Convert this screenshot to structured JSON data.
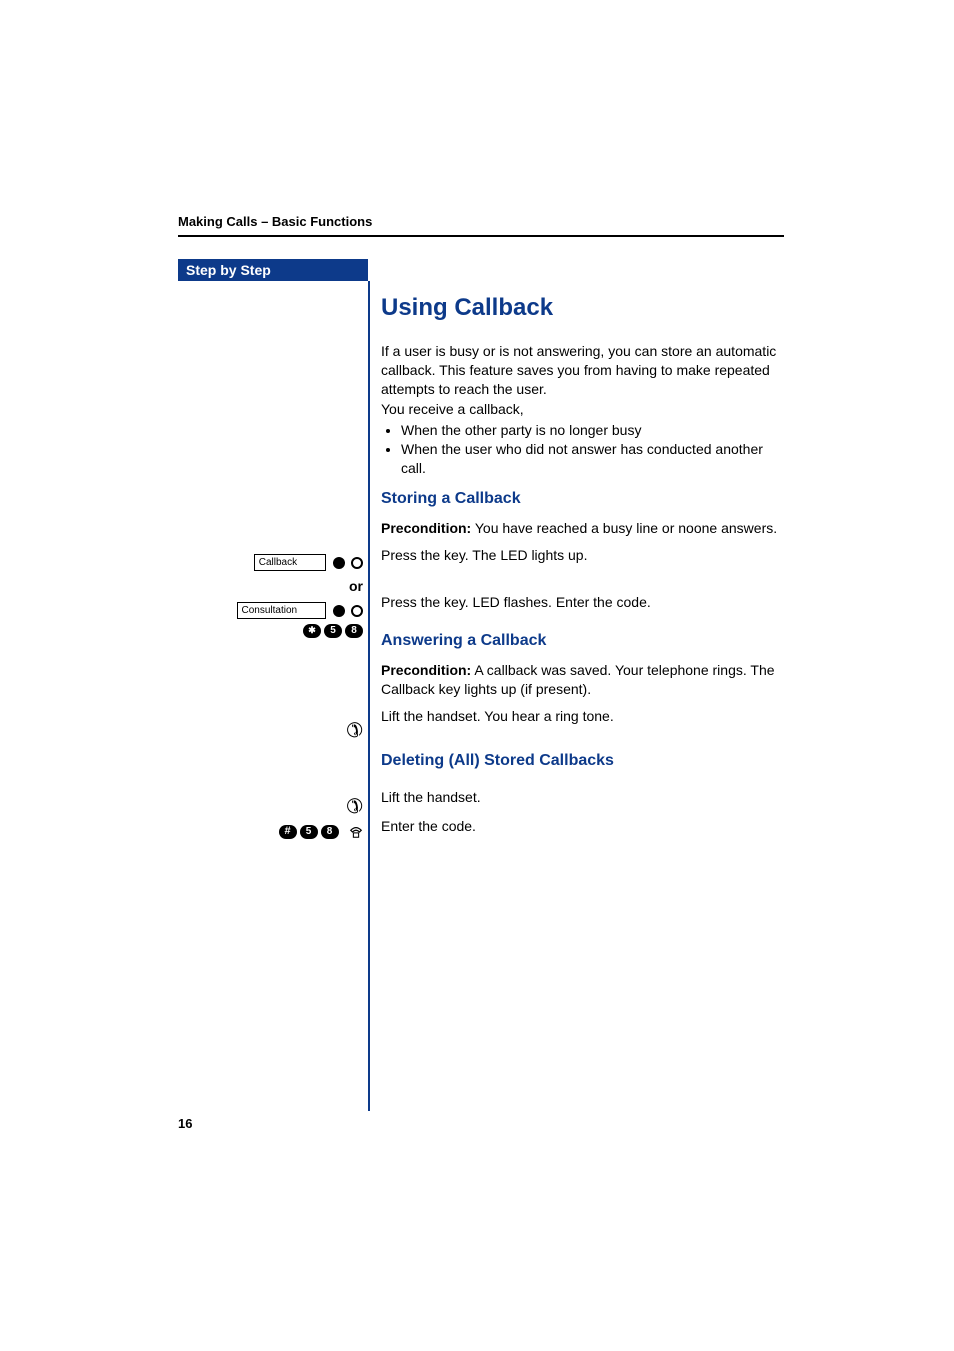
{
  "header": {
    "chapter": "Making Calls – Basic Functions"
  },
  "sidebar": {
    "title": "Step by Step",
    "or_label": "or",
    "keys": {
      "callback": "Callback",
      "consultation": "Consultation"
    },
    "codes": {
      "storing": [
        "*",
        "5",
        "8"
      ],
      "deleting": [
        "#",
        "5",
        "8"
      ]
    }
  },
  "content": {
    "title": "Using Callback",
    "intro": "If a user is busy or is not answering, you can store an automatic callback. This feature saves you from having to make repeated attempts to reach the user.",
    "intro2": "You receive a callback,",
    "bullets": [
      "When the other party is no longer busy",
      "When the user who did not answer has conducted another call."
    ],
    "sections": {
      "storing": {
        "heading": "Storing a Callback",
        "precondition_label": "Precondition:",
        "precondition_text": " You have reached a busy line or noone answers.",
        "step_press_led": "Press the key. The LED lights up.",
        "step_press_flash": "Press the key. LED flashes. Enter the code."
      },
      "answering": {
        "heading": "Answering a Callback",
        "precondition_label": "Precondition:",
        "precondition_text": " A callback was saved. Your telephone rings. The Callback key lights up (if present).",
        "step_lift_ring": "Lift the handset. You hear a ring tone."
      },
      "deleting": {
        "heading": "Deleting (All) Stored Callbacks",
        "step_lift": "Lift the handset.",
        "step_enter_code": "Enter the code."
      }
    }
  },
  "page_number": "16"
}
